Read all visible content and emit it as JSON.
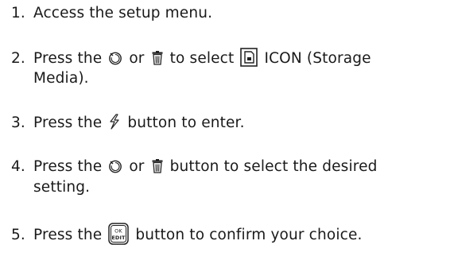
{
  "steps": [
    {
      "number": "1.",
      "parts": [
        "Access the setup menu."
      ]
    },
    {
      "number": "2.",
      "parts": [
        "Press the",
        "or",
        "to select",
        "ICON (Storage",
        "Media)."
      ]
    },
    {
      "number": "3.",
      "parts": [
        "Press the",
        "button to enter."
      ]
    },
    {
      "number": "4.",
      "parts": [
        "Press the",
        "or",
        "button to select the desired",
        "setting."
      ]
    },
    {
      "number": "5.",
      "parts": [
        "Press the",
        "button to confirm your choice."
      ]
    }
  ],
  "icons": {
    "timer": "self-timer-icon",
    "trash": "delete-icon",
    "storage": "storage-media-icon",
    "flash": "flash-icon",
    "ok_edit": "ok-edit-button-icon",
    "ok_label_top": "OK",
    "ok_label_bottom": "EDIT"
  }
}
